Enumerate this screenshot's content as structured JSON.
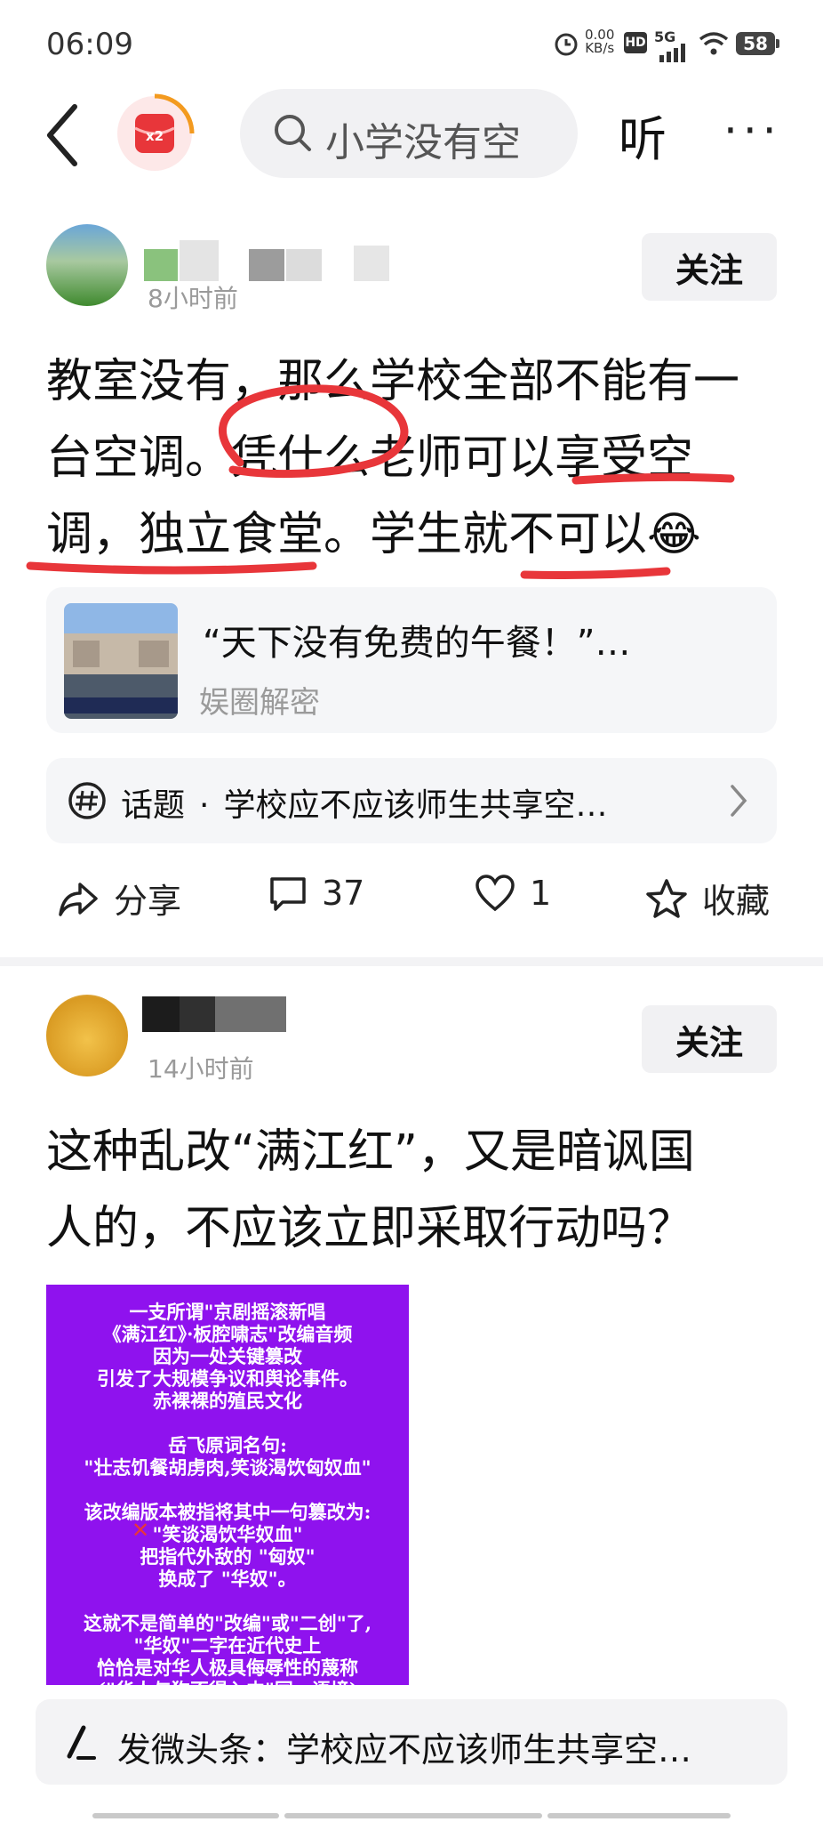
{
  "status_bar": {
    "time": "06:09",
    "net_speed_value": "0.00",
    "net_speed_unit": "KB/s",
    "hd": "HD",
    "network": "5G",
    "battery": "58"
  },
  "top_bar": {
    "redeem_badge": "x2",
    "search_text": "小学没有空",
    "listen_label": "听",
    "more_label": "···"
  },
  "posts": [
    {
      "time": "8小时前",
      "follow_label": "关注",
      "body_lines": [
        "教室没有，那么学校全部不能有一",
        "台空调。凭什么老师可以享受空",
        "调，独立食堂。学生就不可以😂"
      ],
      "link_card": {
        "title": "“天下没有免费的午餐！”…",
        "source": "娱圈解密"
      },
      "topic": {
        "label": "话题",
        "dot": "·",
        "text": "学校应不应该师生共享空…"
      },
      "actions": {
        "share_label": "分享",
        "comment_count": "37",
        "like_count": "1",
        "fav_label": "收藏"
      }
    },
    {
      "time": "14小时前",
      "follow_label": "关注",
      "body_lines": [
        "这种乱改“满江红”，又是暗讽国",
        "人的，不应该立即采取行动吗？"
      ],
      "image_text_lines": [
        "一支所谓\"京剧摇滚新唱",
        "《满江红》·板腔啸志\"改编音频",
        "因为一处关键篡改",
        "引发了大规模争议和舆论事件。",
        "赤裸裸的殖民文化",
        "",
        "岳飞原词名句:",
        "\"壮志饥餐胡虏肉,笑谈渴饮匈奴血\"",
        "",
        "该改编版本被指将其中一句篡改为:",
        "\"笑谈渴饮华奴血\"",
        "把指代外敌的 \"匈奴\"",
        "换成了 \"华奴\"。",
        "",
        "这就不是简单的\"改编\"或\"二创\"了,",
        "\"华奴\"二字在近代史上",
        "恰恰是对华人极具侮辱性的蔑称",
        "(\"华人与狗不得入内\"同一语境)"
      ]
    }
  ],
  "compose": {
    "text": "发微头条：学校应不应该师生共享空…"
  },
  "colors": {
    "accent_red": "#e8363a",
    "image_bg": "#8f12ee"
  }
}
